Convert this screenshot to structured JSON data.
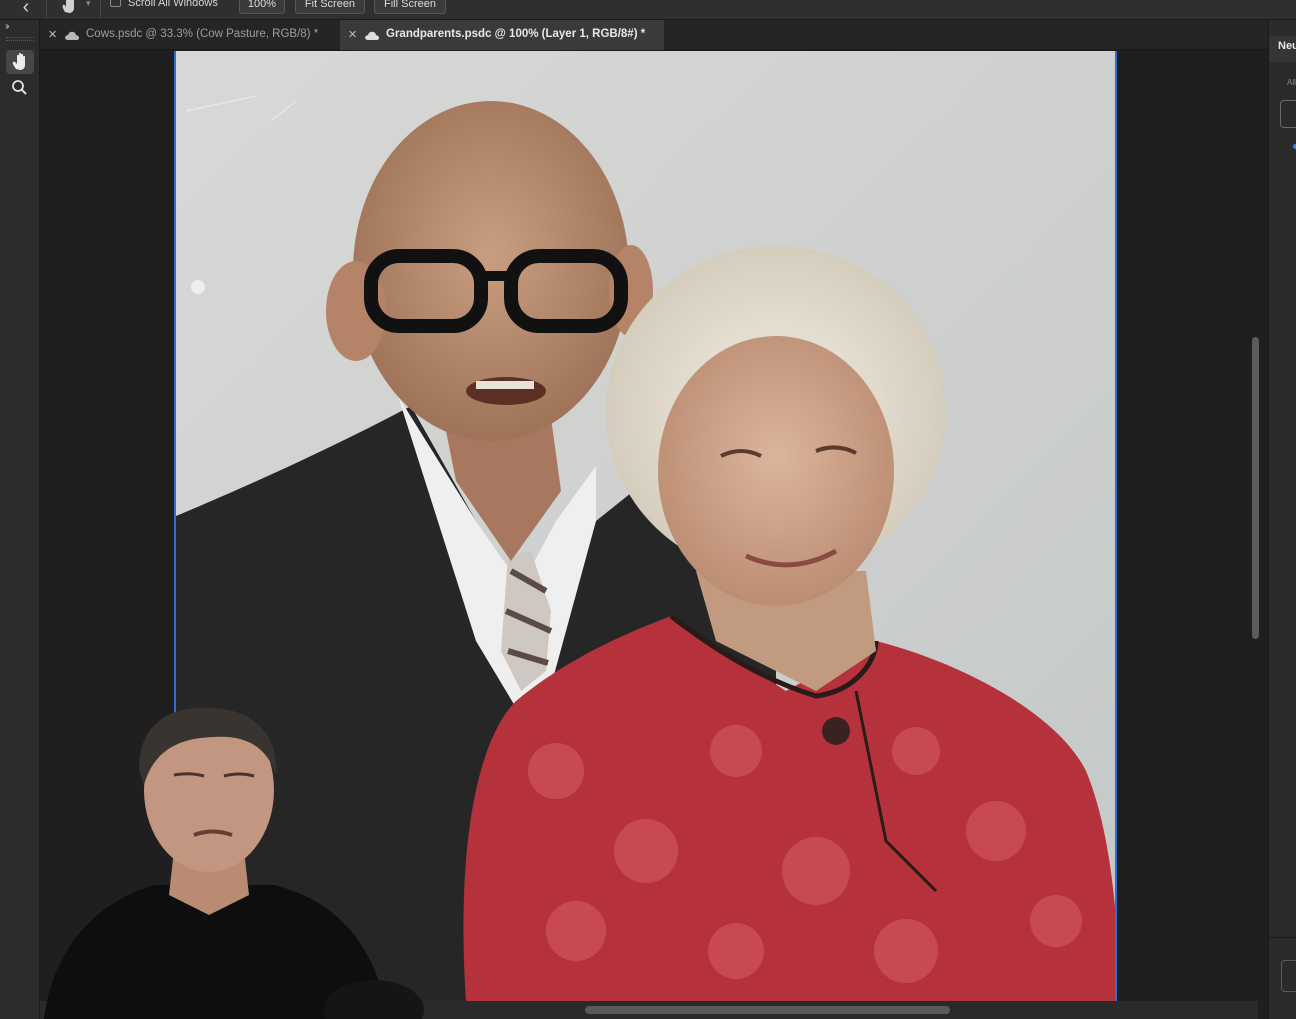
{
  "options_bar": {
    "back_icon": "chevron-left-icon",
    "tool_icon": "hand-icon",
    "scroll_all_windows_label": "Scroll All Windows",
    "scroll_all_windows_checked": false,
    "zoom_button": "100%",
    "fit_screen_button": "Fit Screen",
    "fill_screen_button": "Fill Screen"
  },
  "toolbar": {
    "collapse_label": "››",
    "tools": [
      {
        "name": "hand-tool",
        "icon": "hand-icon",
        "active": true
      },
      {
        "name": "zoom-tool",
        "icon": "magnifier-icon",
        "active": false
      }
    ]
  },
  "tabs": [
    {
      "label": "Cows.psdc @ 33.3% (Cow Pasture, RGB/8) *",
      "active": false,
      "icon": "cloud-icon"
    },
    {
      "label": "Grandparents.psdc @ 100% (Layer 1, RGB/8#) *",
      "active": true,
      "icon": "cloud-icon"
    }
  ],
  "right_panel": {
    "title": "Neu",
    "small_label": "All"
  },
  "colors": {
    "selection_border": "#2f6fd0",
    "panel_bg": "#2c2c2c",
    "canvas_bg": "#1f1f1f",
    "accent_dot": "#3b82f6"
  }
}
